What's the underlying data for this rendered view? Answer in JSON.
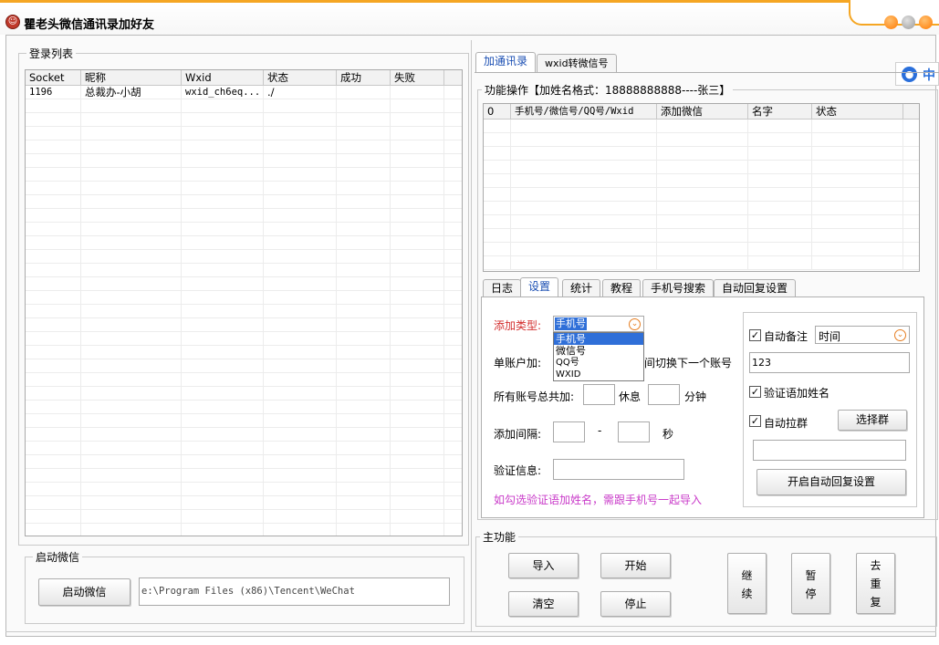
{
  "window": {
    "title": "瞿老头微信通讯录加好友",
    "app_icon": "user-face-icon",
    "dot_colors": [
      "#ff8a00",
      "#a7a7a7",
      "#ff8a00"
    ]
  },
  "login_list": {
    "title": "登录列表",
    "columns": [
      "Socket",
      "昵称",
      "Wxid",
      "状态",
      "成功",
      "失败"
    ],
    "rows": [
      {
        "socket": "1196",
        "nickname": "总裁办-小胡",
        "wxid": "wxid_ch6eq...",
        "status": "./",
        "success": "",
        "fail": ""
      }
    ]
  },
  "launch": {
    "title": "启动微信",
    "button": "启动微信",
    "path": "e:\\Program Files (x86)\\Tencent\\WeChat"
  },
  "top_tabs": [
    "加通讯录",
    "wxid转微信号"
  ],
  "side_badge": {
    "icon": "user-circle-icon",
    "text": "中"
  },
  "func_group": {
    "title": "功能操作【加姓名格式：18888888888----张三】",
    "columns": [
      "0",
      "手机号/微信号/QQ号/Wxid",
      "添加微信",
      "名字",
      "状态"
    ]
  },
  "sub_tabs": [
    "日志",
    "设置",
    "统计",
    "教程",
    "手机号搜索",
    "自动回复设置"
  ],
  "settings": {
    "add_type_label": "添加类型:",
    "add_type_value": "手机号",
    "add_type_options": [
      "手机号",
      "微信号",
      "QQ号",
      "WXID"
    ],
    "single_account_label": "单账户加:",
    "single_account_suffix": "之间切换下一个账号",
    "total_label": "所有账号总共加:",
    "rest_label": "休息",
    "minutes_label": "分钟",
    "interval_label": "添加间隔:",
    "dash": "-",
    "seconds_label": "秒",
    "verify_label": "验证信息:",
    "note": "如勾选验证语加姓名，需跟手机号一起导入"
  },
  "right_options": {
    "auto_remark_label": "自动备注",
    "auto_remark_checked": true,
    "remark_type": "时间",
    "remark_value": "123",
    "verify_name_label": "验证语加姓名",
    "verify_name_checked": true,
    "auto_group_label": "自动拉群",
    "auto_group_checked": true,
    "select_group_button": "选择群",
    "auto_reply_button": "开启自动回复设置"
  },
  "main_func": {
    "title": "主功能",
    "import_button": "导入",
    "start_button": "开始",
    "clear_button": "清空",
    "stop_button": "停止",
    "continue_button": [
      "继",
      "续"
    ],
    "pause_button": [
      "暂",
      "停"
    ],
    "dedupe_button": [
      "去",
      "重",
      "复"
    ]
  }
}
